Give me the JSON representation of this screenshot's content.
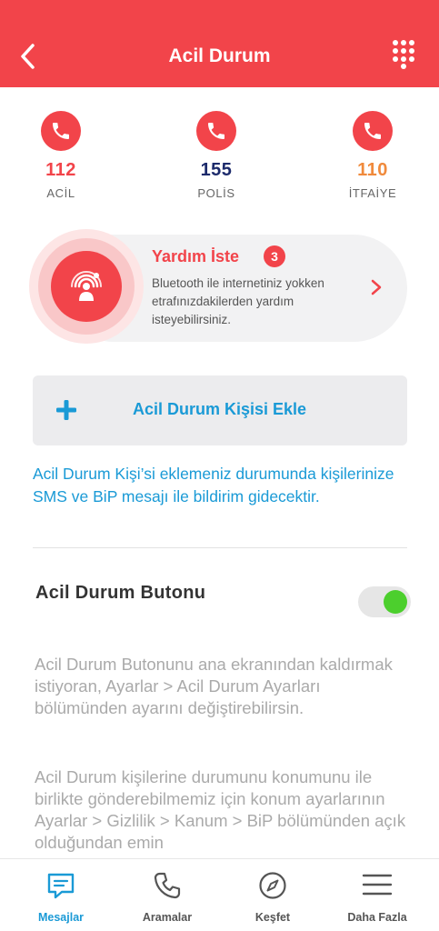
{
  "header": {
    "title": "Acil Durum",
    "back_icon": "chevron-left-icon",
    "dialpad_icon": "dialpad-icon"
  },
  "numbers": [
    {
      "number": "112",
      "label": "ACİL",
      "color": "#f2444a"
    },
    {
      "number": "155",
      "label": "POLİS",
      "color": "#1c2a6b"
    },
    {
      "number": "110",
      "label": "İTFAİYE",
      "color": "#f08a3c"
    }
  ],
  "help": {
    "title": "Yardım İste",
    "badge": "3",
    "description": "Bluetooth ile internetiniz yokken etrafınızdakilerden yardım isteyebilirsiniz."
  },
  "add_contact": {
    "label": "Acil Durum Kişisi Ekle"
  },
  "info_text": "Acil Durum Kişi’si eklemeniz durumunda kişilerinize SMS ve BiP mesajı ile bildirim gidecektir.",
  "emergency_button": {
    "title": "Acil Durum Butonu",
    "enabled": true
  },
  "paragraphs": {
    "p1": "Acil Durum Butonunu ana ekranından kaldırmak istiyoran, Ayarlar > Acil Durum Ayarları bölümünden ayarını değiştirebilirsin.",
    "p2": "Acil Durum kişilerine durumunu konumunu ile birlikte gönderebilmemiz için konum ayarlarının Ayarlar > Gizlilik > Kanum > BiP bölümünden açık olduğundan emin"
  },
  "tabs": [
    {
      "label": "Mesajlar",
      "icon": "chat-icon",
      "active": true
    },
    {
      "label": "Aramalar",
      "icon": "phone-icon",
      "active": false
    },
    {
      "label": "Keşfet",
      "icon": "compass-icon",
      "active": false
    },
    {
      "label": "Daha Fazla",
      "icon": "menu-icon",
      "active": false
    }
  ],
  "colors": {
    "brand": "#f2444a",
    "accent": "#1a9ad6",
    "toggle_on": "#4ccf2d"
  }
}
